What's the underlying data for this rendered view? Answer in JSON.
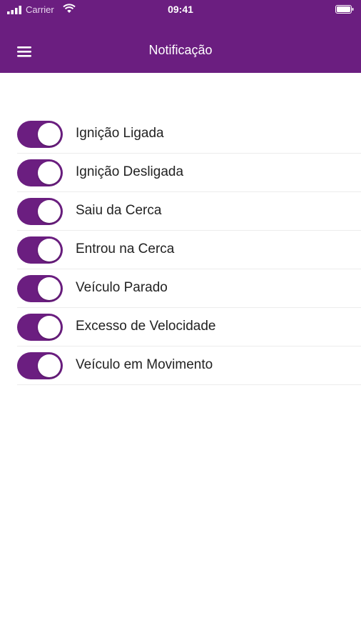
{
  "status_bar": {
    "carrier": "Carrier",
    "time": "09:41"
  },
  "header": {
    "title": "Notificação",
    "background_color": "#6b1e80",
    "menu_icon": "hamburger-menu-icon"
  },
  "notifications": [
    {
      "label": "Ignição Ligada",
      "enabled": true
    },
    {
      "label": "Ignição Desligada",
      "enabled": true
    },
    {
      "label": "Saiu da Cerca",
      "enabled": true
    },
    {
      "label": "Entrou na Cerca",
      "enabled": true
    },
    {
      "label": "Veículo Parado",
      "enabled": true
    },
    {
      "label": "Excesso de Velocidade",
      "enabled": true
    },
    {
      "label": "Veículo em Movimento",
      "enabled": true
    }
  ],
  "colors": {
    "accent": "#6b1e80",
    "toggle_on": "#6b1e80",
    "knob": "#ffffff",
    "divider": "#ececec"
  }
}
